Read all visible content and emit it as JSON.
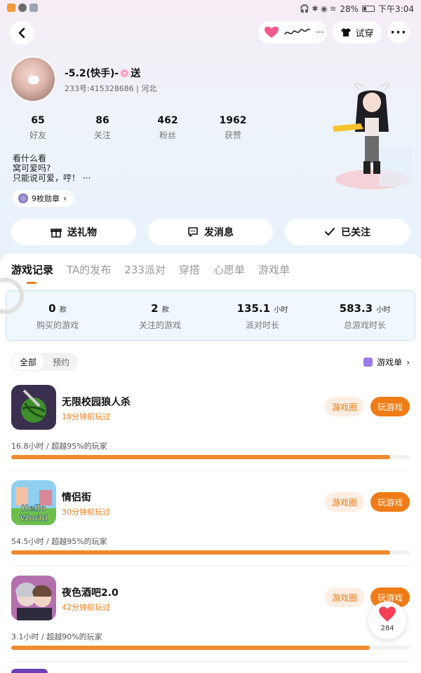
{
  "status_bar": {
    "battery": "28%",
    "time": "下午3:04"
  },
  "header": {
    "tryon_label": "试穿",
    "more": "···",
    "back": "‹"
  },
  "profile": {
    "nickname": "-5.2(快手)-",
    "nickname_suffix": "送",
    "uid_line": "233号:415328686 | 河北",
    "stats": [
      {
        "num": "65",
        "label": "好友"
      },
      {
        "num": "86",
        "label": "关注"
      },
      {
        "num": "462",
        "label": "粉丝"
      },
      {
        "num": "1962",
        "label": "获赞"
      }
    ],
    "bio": [
      "看什么看",
      "窝可爱吗?",
      "只能说可爱，哼！ ···"
    ],
    "medal": "9枚勋章"
  },
  "actions": {
    "gift": "送礼物",
    "message": "发消息",
    "followed": "已关注"
  },
  "tabs": [
    "游戏记录",
    "TA的发布",
    "233派对",
    "穿搭",
    "心愿单",
    "游戏单"
  ],
  "summary": [
    {
      "value": "0",
      "unit": "款",
      "label": "购买的游戏"
    },
    {
      "value": "2",
      "unit": "款",
      "label": "关注的游戏"
    },
    {
      "value": "135.1",
      "unit": "小时",
      "label": "派对时长"
    },
    {
      "value": "583.3",
      "unit": "小时",
      "label": "总游戏时长"
    }
  ],
  "filter": {
    "all": "全部",
    "reserve": "预约",
    "gamelist": "游戏单"
  },
  "games": [
    {
      "name": "无限校园狼人杀",
      "last_played": "18分钟前玩过",
      "hours": "16.8小时 / 超越95%的玩家",
      "progress": 0.95,
      "circle_btn": "游戏圈",
      "play_btn": "玩游戏"
    },
    {
      "name": "情侣街",
      "last_played": "30分钟前玩过",
      "hours": "54.5小时 / 超越95%的玩家",
      "progress": 0.95,
      "circle_btn": "游戏圈",
      "play_btn": "玩游戏",
      "icon_text": [
        "Hello",
        "World"
      ]
    },
    {
      "name": "夜色酒吧2.0",
      "last_played": "42分钟前玩过",
      "hours": "3.1小时 / 超越90%的玩家",
      "progress": 0.9,
      "circle_btn": "游戏圈",
      "play_btn": "玩游戏"
    }
  ],
  "float_like": {
    "count": "284"
  },
  "colors": {
    "accent": "#f07c17",
    "accent_light": "#fdeee3",
    "summary_bg": "#f0f7fd"
  }
}
